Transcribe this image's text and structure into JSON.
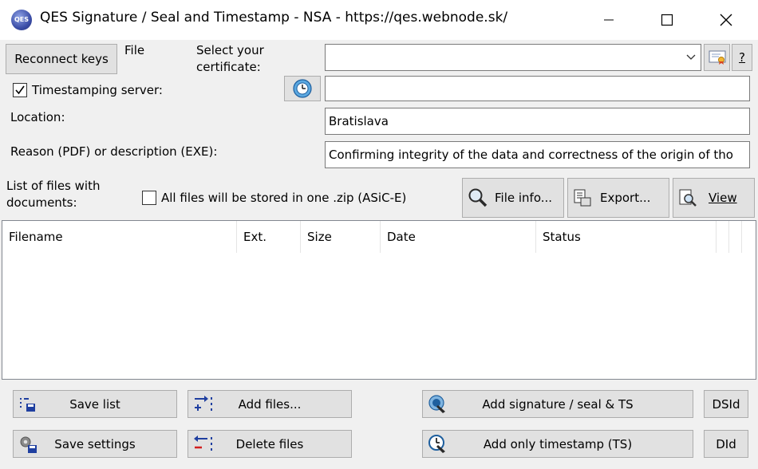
{
  "window": {
    "title": "QES Signature / Seal and Timestamp - NSA - https://qes.webnode.sk/",
    "app_icon_text": "QES",
    "icons": [
      "minimize-icon",
      "maximize-icon",
      "close-icon"
    ]
  },
  "top": {
    "reconnect_label": "Reconnect keys",
    "file_label": "File",
    "certificate_label_1": "Select your",
    "certificate_label_2": "certificate:",
    "certificate_value": "",
    "help_label": "?",
    "timestamp_label": "Timestamping server:",
    "timestamp_checked": true,
    "timestamp_value": "",
    "location_label": "Location:",
    "location_value": "Bratislava",
    "reason_label": "Reason (PDF) or description (EXE):",
    "reason_value": "Confirming integrity of the data and correctness of the origin of tho"
  },
  "files": {
    "list_label_1": "List of files with",
    "list_label_2": "documents:",
    "zip_label": "All files will be stored in one .zip  (ASiC-E)",
    "zip_checked": false,
    "file_info_label": "File info...",
    "export_label": "Export...",
    "view_label": "View",
    "columns": [
      "Filename",
      "Ext.",
      "Size",
      "Date",
      "Status"
    ],
    "rows": []
  },
  "actions": {
    "save_list": "Save list",
    "add_files": "Add files...",
    "add_signature": "Add signature / seal & TS",
    "dsid": "DSId",
    "save_settings": "Save settings",
    "delete_files": "Delete files",
    "add_timestamp": "Add only timestamp (TS)",
    "did": "DId"
  }
}
